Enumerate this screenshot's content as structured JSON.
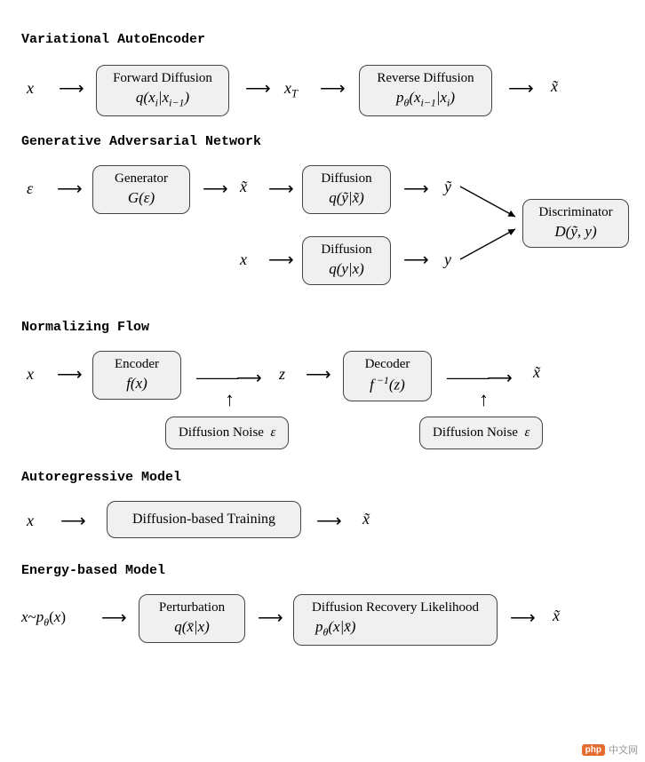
{
  "sections": {
    "vae": {
      "title": "Variational AutoEncoder",
      "input_sym": "x",
      "box1_label": "Forward Diffusion",
      "box1_formula": "q(xᵢ|xᵢ₋₁)",
      "mid_sym": "x_T",
      "box2_label": "Reverse Diffusion",
      "box2_formula": "p_θ(xᵢ₋₁|xᵢ)",
      "output_sym": "x̃"
    },
    "gan": {
      "title": "Generative Adversarial Network",
      "eps_sym": "ε",
      "gen_label": "Generator",
      "gen_formula": "G(ε)",
      "xtilde_sym": "x̃",
      "diff1_label": "Diffusion",
      "diff1_formula": "q(ỹ|x̃)",
      "ytilde_sym": "ỹ",
      "x_sym": "x",
      "diff2_label": "Diffusion",
      "diff2_formula": "q(y|x)",
      "y_sym": "y",
      "disc_label": "Discriminator",
      "disc_formula": "D(ỹ, y)"
    },
    "flow": {
      "title": "Normalizing Flow",
      "x_sym": "x",
      "enc_label": "Encoder",
      "enc_formula": "f(x)",
      "z_sym": "z",
      "dec_label": "Decoder",
      "dec_formula": "f⁻¹(z)",
      "xtilde_sym": "x̃",
      "noise1_label": "Diffusion Noise  ε",
      "noise2_label": "Diffusion Noise  ε"
    },
    "ar": {
      "title": "Autoregressive Model",
      "x_sym": "x",
      "box_label": "Diffusion-based Training",
      "xtilde_sym": "x̃"
    },
    "ebm": {
      "title": "Energy-based Model",
      "lhs": "x~p_θ(x)",
      "pert_label": "Perturbation",
      "pert_formula": "q(x̄|x)",
      "rec_label": "Diffusion Recovery Likelihood",
      "rec_formula": "p_θ(x|x̄)",
      "xtilde_sym": "x̃"
    }
  },
  "watermark": {
    "badge": "php",
    "text": "中文网"
  }
}
